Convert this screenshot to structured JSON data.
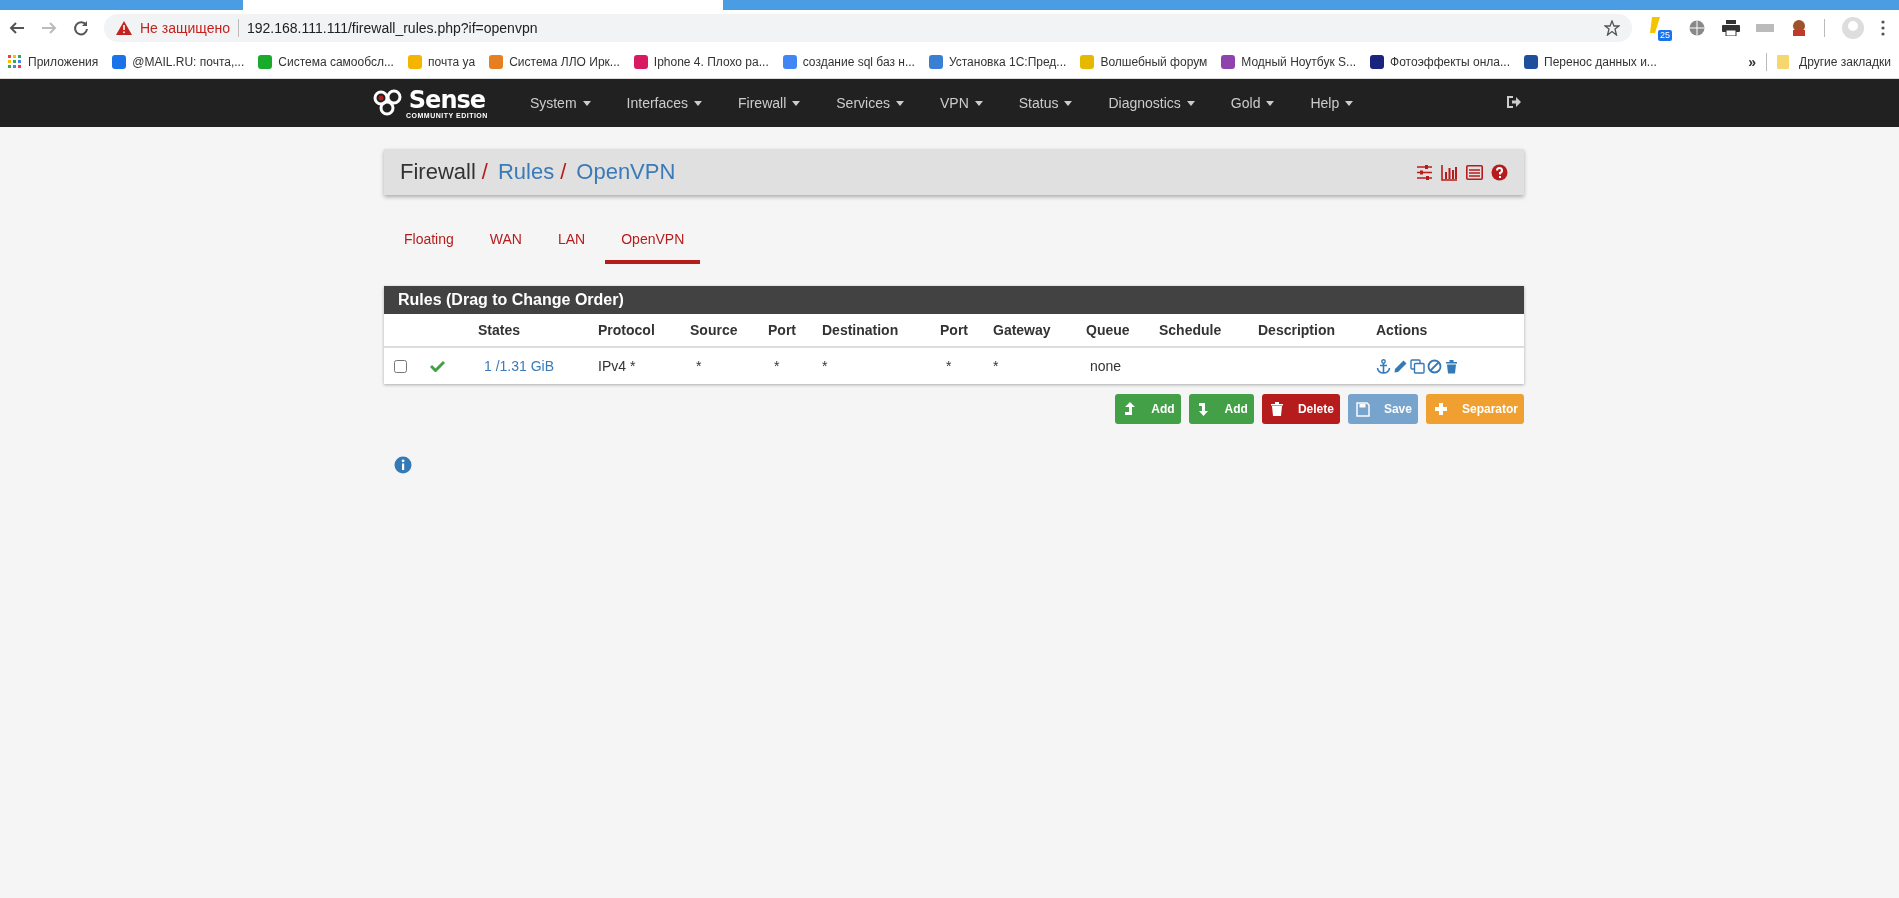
{
  "browser": {
    "security_label": "Не защищено",
    "url": "192.168.111.111/firewall_rules.php?if=openvpn",
    "extension_badge": "25",
    "bookmarks": [
      {
        "label": "Приложения"
      },
      {
        "label": "@MAIL.RU: почта,..."
      },
      {
        "label": "Система самообсл..."
      },
      {
        "label": "почта ya"
      },
      {
        "label": "Система ЛЛО Ирк..."
      },
      {
        "label": "Iphone 4. Плохо ра..."
      },
      {
        "label": "создание sql баз н..."
      },
      {
        "label": "Установка 1С:Пред..."
      },
      {
        "label": "Волшебный форум"
      },
      {
        "label": "Модный Ноутбук S..."
      },
      {
        "label": "Фотоэффекты онла..."
      },
      {
        "label": "Перенос данных и..."
      }
    ],
    "more": "»",
    "other_bookmarks": "Другие закладки"
  },
  "navbar": {
    "logo_text": "Sense",
    "logo_subtitle": "COMMUNITY EDITION",
    "menu": [
      {
        "label": "System"
      },
      {
        "label": "Interfaces"
      },
      {
        "label": "Firewall"
      },
      {
        "label": "Services"
      },
      {
        "label": "VPN"
      },
      {
        "label": "Status"
      },
      {
        "label": "Diagnostics"
      },
      {
        "label": "Gold"
      },
      {
        "label": "Help"
      }
    ]
  },
  "breadcrumb": [
    {
      "label": "Firewall",
      "link": false
    },
    {
      "label": "Rules",
      "link": true
    },
    {
      "label": "OpenVPN",
      "link": true
    }
  ],
  "breadcrumb_separator": "/",
  "tabs": [
    {
      "label": "Floating",
      "selected": false
    },
    {
      "label": "WAN",
      "selected": false
    },
    {
      "label": "LAN",
      "selected": false
    },
    {
      "label": "OpenVPN",
      "selected": true
    }
  ],
  "rules_panel": {
    "title": "Rules (Drag to Change Order)",
    "columns": [
      "States",
      "Protocol",
      "Source",
      "Port",
      "Destination",
      "Port",
      "Gateway",
      "Queue",
      "Schedule",
      "Description",
      "Actions"
    ],
    "rows": [
      {
        "checked": false,
        "enabled": true,
        "states": "1 /1.31 GiB",
        "protocol": "IPv4 *",
        "source": "*",
        "source_port": "*",
        "destination": "*",
        "destination_port": "*",
        "gateway": "*",
        "queue": "none"
      }
    ]
  },
  "buttons": [
    {
      "kind": "add_top",
      "label": "Add",
      "disabled": false
    },
    {
      "kind": "add_bottom",
      "label": "Add",
      "disabled": false
    },
    {
      "kind": "delete",
      "label": "Delete",
      "disabled": false
    },
    {
      "kind": "save",
      "label": "Save",
      "disabled": true
    },
    {
      "kind": "separator",
      "label": "Separator",
      "disabled": false
    }
  ]
}
